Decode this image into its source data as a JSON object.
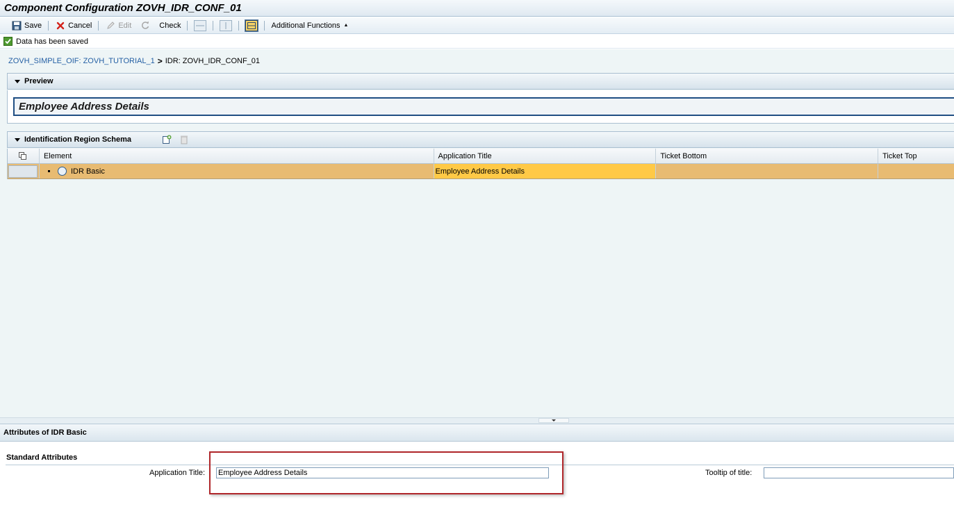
{
  "window": {
    "title": "Component Configuration ZOVH_IDR_CONF_01"
  },
  "toolbar": {
    "save_label": "Save",
    "cancel_label": "Cancel",
    "edit_label": "Edit",
    "check_label": "Check",
    "additional_functions_label": "Additional Functions"
  },
  "message": {
    "text": "Data has been saved",
    "status_color": "#4f9a2f"
  },
  "breadcrumb": {
    "link": "ZOVH_SIMPLE_OIF: ZOVH_TUTORIAL_1",
    "separator": ">",
    "current": "IDR: ZOVH_IDR_CONF_01"
  },
  "preview": {
    "title": "Preview",
    "application_title": "Employee Address Details"
  },
  "schema": {
    "title": "Identification Region Schema",
    "columns": [
      "Element",
      "Application Title",
      "Ticket Bottom",
      "Ticket Top"
    ],
    "rows": [
      {
        "element": "IDR Basic",
        "application_title": "Employee Address Details",
        "ticket_bottom": "",
        "ticket_top": ""
      }
    ]
  },
  "attributes": {
    "title": "Attributes of IDR Basic",
    "section": "Standard Attributes",
    "application_title_label": "Application Title:",
    "application_title_value": "Employee Address Details",
    "tooltip_label": "Tooltip of title:",
    "tooltip_value": ""
  },
  "colors": {
    "accent": "#2560a4",
    "selected_row": "#e8bb72",
    "selected_cell": "#ffc946",
    "highlight_border": "#b0262a"
  }
}
